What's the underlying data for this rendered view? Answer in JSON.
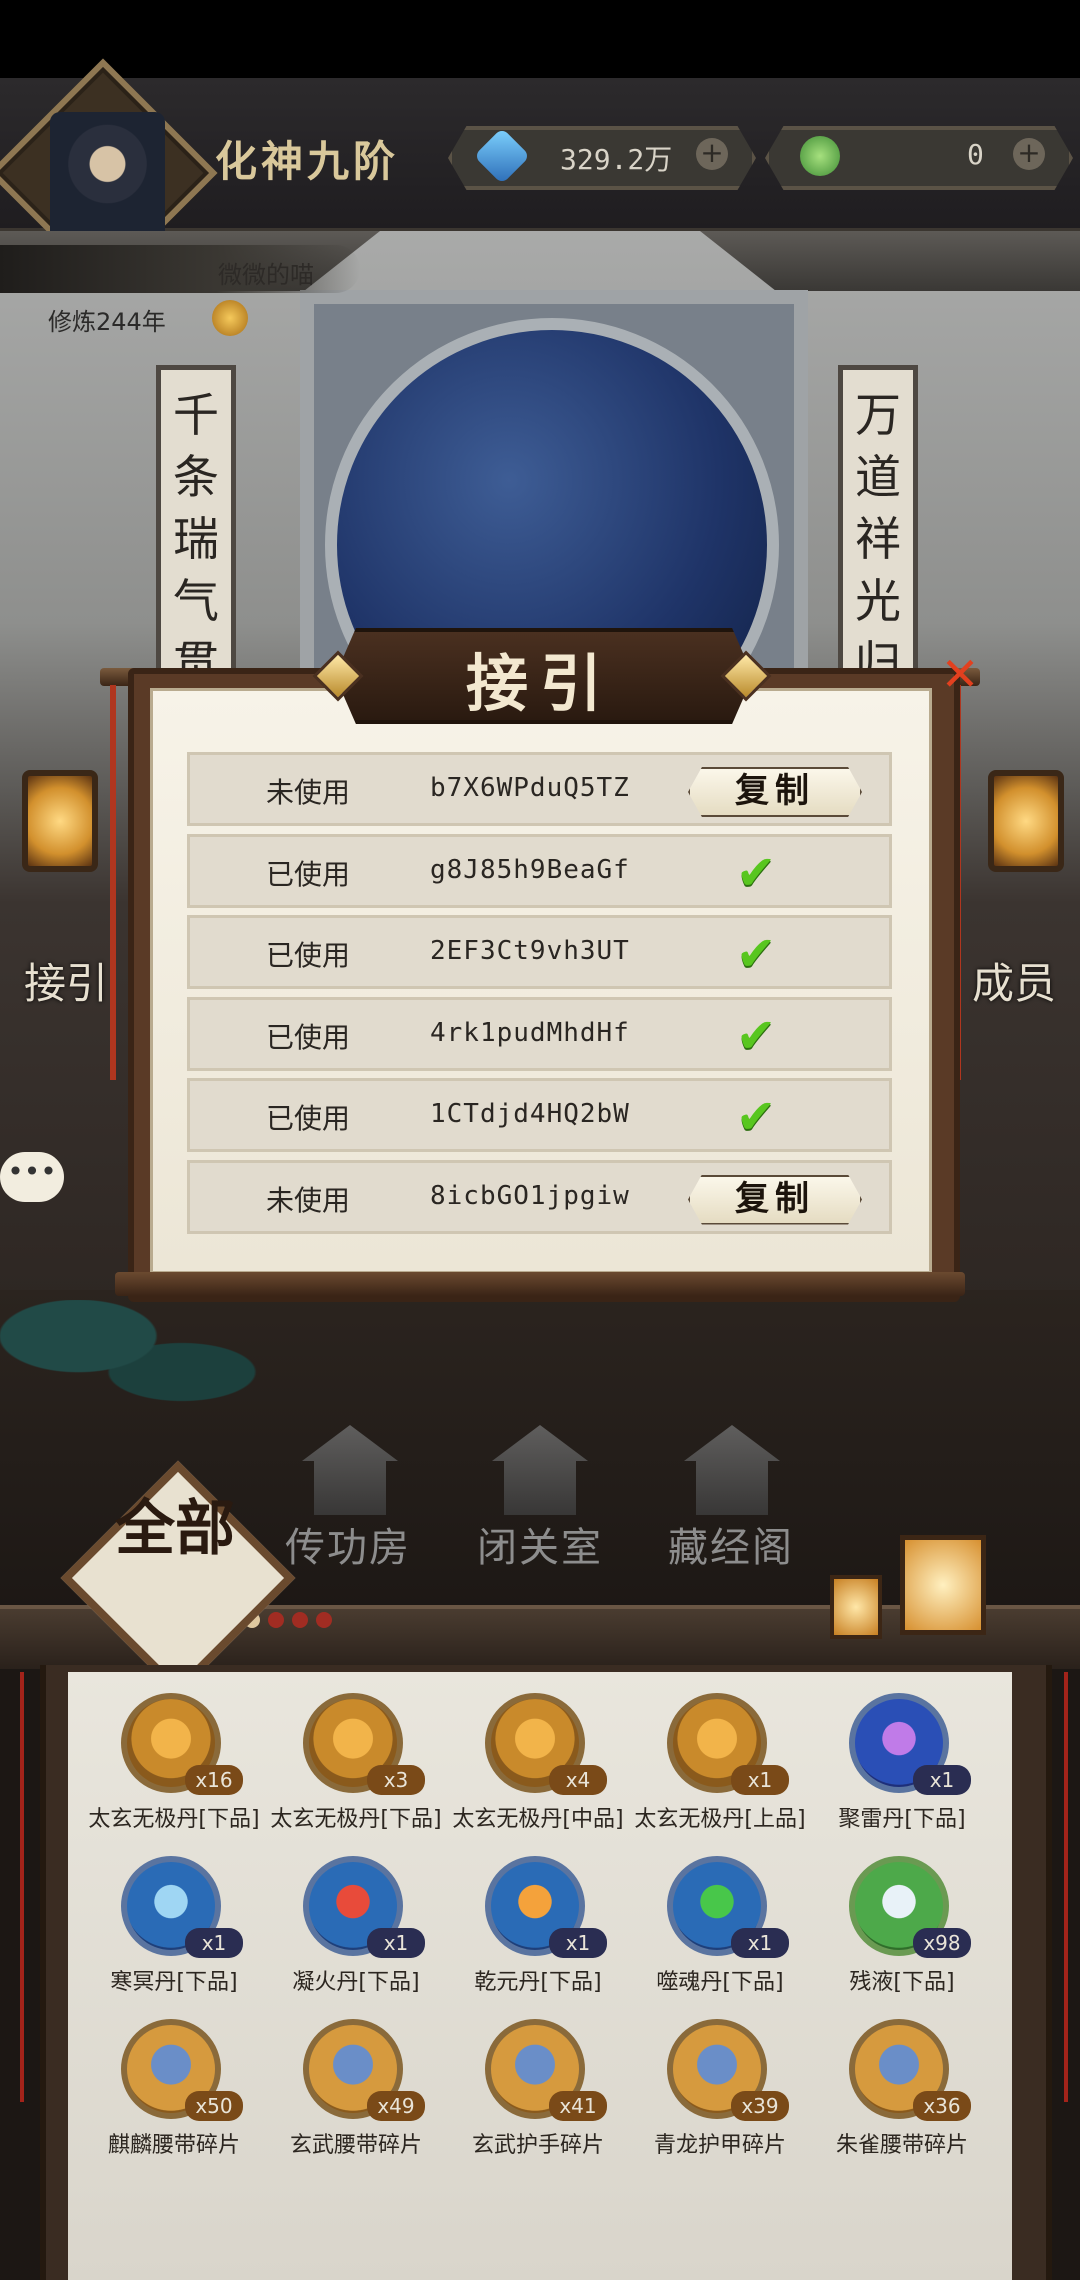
{
  "header": {
    "realm": "化神九阶",
    "resource_1": {
      "value": "329.2万",
      "icon": "spirit-crystal-icon",
      "plus": "+"
    },
    "resource_2": {
      "value": "0",
      "icon": "jade-icon",
      "plus": "+"
    }
  },
  "profile": {
    "username": "微微的喵",
    "cultivation": "修炼244年"
  },
  "scene": {
    "couplet_left": "千条瑞气贯",
    "couplet_right": "万道祥光归",
    "side_left": "接引",
    "side_right": "成员",
    "chat": "•••"
  },
  "nav": {
    "all_label": "全部",
    "items": [
      {
        "label": "传功房"
      },
      {
        "label": "闭关室"
      },
      {
        "label": "藏经阁"
      }
    ]
  },
  "modal": {
    "title": "接引",
    "close": "✕",
    "copy_label": "复制",
    "rows": [
      {
        "status": "未使用",
        "code": "b7X6WPduQ5TZ",
        "action": "copy"
      },
      {
        "status": "已使用",
        "code": "g8J85h9BeaGf",
        "action": "check"
      },
      {
        "status": "已使用",
        "code": "2EF3Ct9vh3UT",
        "action": "check"
      },
      {
        "status": "已使用",
        "code": "4rk1pudMhdHf",
        "action": "check"
      },
      {
        "status": "已使用",
        "code": "1CTdjd4HQ2bW",
        "action": "check"
      },
      {
        "status": "未使用",
        "code": "8icbGO1jpgiw",
        "action": "copy"
      }
    ]
  },
  "inventory": {
    "items": [
      {
        "name": "太玄无极丹[下品]",
        "count": "x16",
        "style": "gold"
      },
      {
        "name": "太玄无极丹[下品]",
        "count": "x3",
        "style": "gold"
      },
      {
        "name": "太玄无极丹[中品]",
        "count": "x4",
        "style": "gold"
      },
      {
        "name": "太玄无极丹[上品]",
        "count": "x1",
        "style": "gold"
      },
      {
        "name": "聚雷丹[下品]",
        "count": "x1",
        "style": "purple"
      },
      {
        "name": "寒冥丹[下品]",
        "count": "x1",
        "style": "blue"
      },
      {
        "name": "凝火丹[下品]",
        "count": "x1",
        "style": "red"
      },
      {
        "name": "乾元丹[下品]",
        "count": "x1",
        "style": "orange"
      },
      {
        "name": "噬魂丹[下品]",
        "count": "x1",
        "style": "green"
      },
      {
        "name": "残液[下品]",
        "count": "x98",
        "style": "lime"
      },
      {
        "name": "麒麟腰带碎片",
        "count": "x50",
        "style": "piece"
      },
      {
        "name": "玄武腰带碎片",
        "count": "x49",
        "style": "piece"
      },
      {
        "name": "玄武护手碎片",
        "count": "x41",
        "style": "piece"
      },
      {
        "name": "青龙护甲碎片",
        "count": "x39",
        "style": "piece"
      },
      {
        "name": "朱雀腰带碎片",
        "count": "x36",
        "style": "piece"
      }
    ]
  }
}
